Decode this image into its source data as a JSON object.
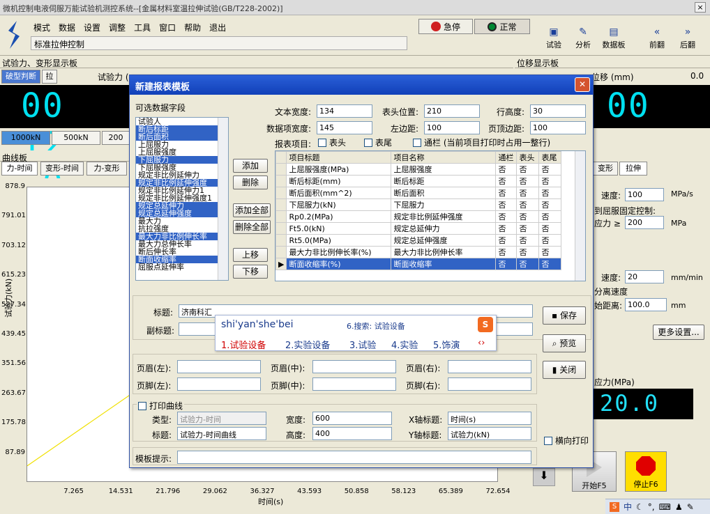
{
  "window": {
    "title": "微机控制电液伺服万能试验机测控系统--[金属材料室温拉伸试验(GB/T228-2002)]",
    "close": "×"
  },
  "menu": {
    "items": [
      "模式",
      "数据",
      "设置",
      "调整",
      "工具",
      "窗口",
      "帮助",
      "退出"
    ],
    "mode_label": "标准拉伸控制"
  },
  "toolbar": {
    "emergency": "急停",
    "normal": "正常",
    "buttons": [
      "试验",
      "分析",
      "数据板",
      "前翻",
      "后翻"
    ]
  },
  "left": {
    "force_header": "试验力、变形显示板",
    "break_btn": "破型判断",
    "la": "拉",
    "force_label": "试验力 (",
    "lcd": "00 12 .0",
    "ranges": [
      "1000kN",
      "500kN",
      "200"
    ],
    "curve_header": "曲线板",
    "curve_tabs": [
      "力-时间",
      "变形-时间",
      "力-变形"
    ],
    "chart_data": {
      "type": "line",
      "ylabel": "试验力(kN)",
      "xlabel": "时间(s)",
      "yticks": [
        "878.9",
        "791.01",
        "703.12",
        "615.23",
        "527.34",
        "439.45",
        "351.56",
        "263.67",
        "175.78",
        "87.89"
      ],
      "xticks": [
        "7.265",
        "14.531",
        "21.796",
        "29.062",
        "36.327",
        "43.593",
        "50.858",
        "58.123",
        "65.389",
        "72.654"
      ],
      "ylim": [
        0,
        878.9
      ],
      "xlim": [
        0,
        72.654
      ],
      "series": [
        {
          "x": [
            0,
            18
          ],
          "y": [
            50,
            290
          ]
        }
      ]
    }
  },
  "right": {
    "disp_header": "位移显示板",
    "disp_label": "位移 (mm)",
    "disp_val": "0.0",
    "lcd": "00",
    "tabs": [
      "变形",
      "拉伸"
    ],
    "speed_label": "速度:",
    "speed_val": "100",
    "speed_unit": "MPa/s",
    "yield_ctrl": "到屈服固定控制:",
    "stress_label": "应力 ≥",
    "stress_val": "200",
    "stress_unit": "MPa",
    "speed2_label": "速度:",
    "speed2_val": "20",
    "speed2_unit": "mm/min",
    "sep_speed": "分离速度",
    "start_dist_label": "始距离:",
    "start_dist_val": "100.0",
    "start_dist_unit": "mm",
    "more": "更多设置...",
    "stress_disp_label": "应力(MPa)",
    "stress_disp_val": "20.0",
    "start": "开始F5",
    "stop": "停止F6"
  },
  "dialog": {
    "title": "新建报表模板",
    "fields_label": "可选数据字段",
    "fields": [
      {
        "t": "试验人",
        "s": false
      },
      {
        "t": "断后标距",
        "s": true
      },
      {
        "t": "断后面积",
        "s": true
      },
      {
        "t": "上屈服力",
        "s": false
      },
      {
        "t": "上屈服强度",
        "s": false
      },
      {
        "t": "下屈服力",
        "s": true
      },
      {
        "t": "下屈服强度",
        "s": false
      },
      {
        "t": "规定非比例延伸力",
        "s": false
      },
      {
        "t": "规定非比例延伸强度",
        "s": true
      },
      {
        "t": "规定非比例延伸力1",
        "s": false
      },
      {
        "t": "规定非比例延伸强度1",
        "s": false
      },
      {
        "t": "规定总延伸力",
        "s": true
      },
      {
        "t": "规定总延伸强度",
        "s": true
      },
      {
        "t": "最大力",
        "s": false
      },
      {
        "t": "抗拉强度",
        "s": false
      },
      {
        "t": "最大力非比例伸长率",
        "s": true
      },
      {
        "t": "最大力总伸长率",
        "s": false
      },
      {
        "t": "断后伸长率",
        "s": false
      },
      {
        "t": "断面收缩率",
        "s": true
      },
      {
        "t": "屈服点延伸率",
        "s": false
      }
    ],
    "add": "添加",
    "del": "删除",
    "add_all": "添加全部",
    "del_all": "删除全部",
    "up": "上移",
    "down": "下移",
    "text_width_label": "文本宽度:",
    "text_width": "134",
    "header_pos_label": "表头位置:",
    "header_pos": "210",
    "row_h_label": "行高度:",
    "row_h": "30",
    "item_w_label": "数据项宽度:",
    "item_w": "145",
    "left_margin_label": "左边距:",
    "left_margin": "100",
    "top_margin_label": "页顶边距:",
    "top_margin": "100",
    "report_items": "报表项目:",
    "header_cb": "表头",
    "footer_cb": "表尾",
    "span_cb": "通栏 (当前项目打印时占用一整行)",
    "grid_head": [
      "项目标题",
      "项目名称",
      "通栏",
      "表头",
      "表尾"
    ],
    "grid_rows": [
      [
        "上屈服强度(MPa)",
        "上屈服强度",
        "否",
        "否",
        "否"
      ],
      [
        "断后标距(mm)",
        "断后标距",
        "否",
        "否",
        "否"
      ],
      [
        "断后面积(mm^2)",
        "断后面积",
        "否",
        "否",
        "否"
      ],
      [
        "下屈服力(kN)",
        "下屈服力",
        "否",
        "否",
        "否"
      ],
      [
        "Rp0.2(MPa)",
        "规定非比例延伸强度",
        "否",
        "否",
        "否"
      ],
      [
        "Ft5.0(kN)",
        "规定总延伸力",
        "否",
        "否",
        "否"
      ],
      [
        "Rt5.0(MPa)",
        "规定总延伸强度",
        "否",
        "否",
        "否"
      ],
      [
        "最大力非比例伸长率(%)",
        "最大力非比例伸长率",
        "否",
        "否",
        "否"
      ],
      [
        "断面收缩率(%)",
        "断面收缩率",
        "否",
        "否",
        "否"
      ]
    ],
    "title_label": "标题:",
    "title_val": "济南科汇",
    "subtitle_label": "副标题:",
    "save": "保存",
    "preview": "预览",
    "close": "关闭",
    "hl": "页眉(左):",
    "hm": "页眉(中):",
    "hr": "页眉(右):",
    "fl": "页脚(左):",
    "fm": "页脚(中):",
    "fr": "页脚(右):",
    "print_curve": "打印曲线",
    "type_label": "类型:",
    "type_val": "试验力-时间",
    "width_label": "宽度:",
    "width_val": "600",
    "xtitle_label": "X轴标题:",
    "xtitle_val": "时间(s)",
    "ctitle_label": "标题:",
    "ctitle_val": "试验力-时间曲线",
    "height_label": "高度:",
    "height_val": "400",
    "ytitle_label": "Y轴标题:",
    "ytitle_val": "试验力(kN)",
    "landscape": "横向打印",
    "hint_label": "模板提示:"
  },
  "ime": {
    "pinyin": "shi'yan'she'bei",
    "search": "6.搜索: 试验设备",
    "c1": "1.试验设备",
    "c2": "2.实验设备",
    "c3": "3.试验",
    "c4": "4.实验",
    "c5": "5.饰演"
  },
  "taskbar": {
    "zh": "中"
  }
}
